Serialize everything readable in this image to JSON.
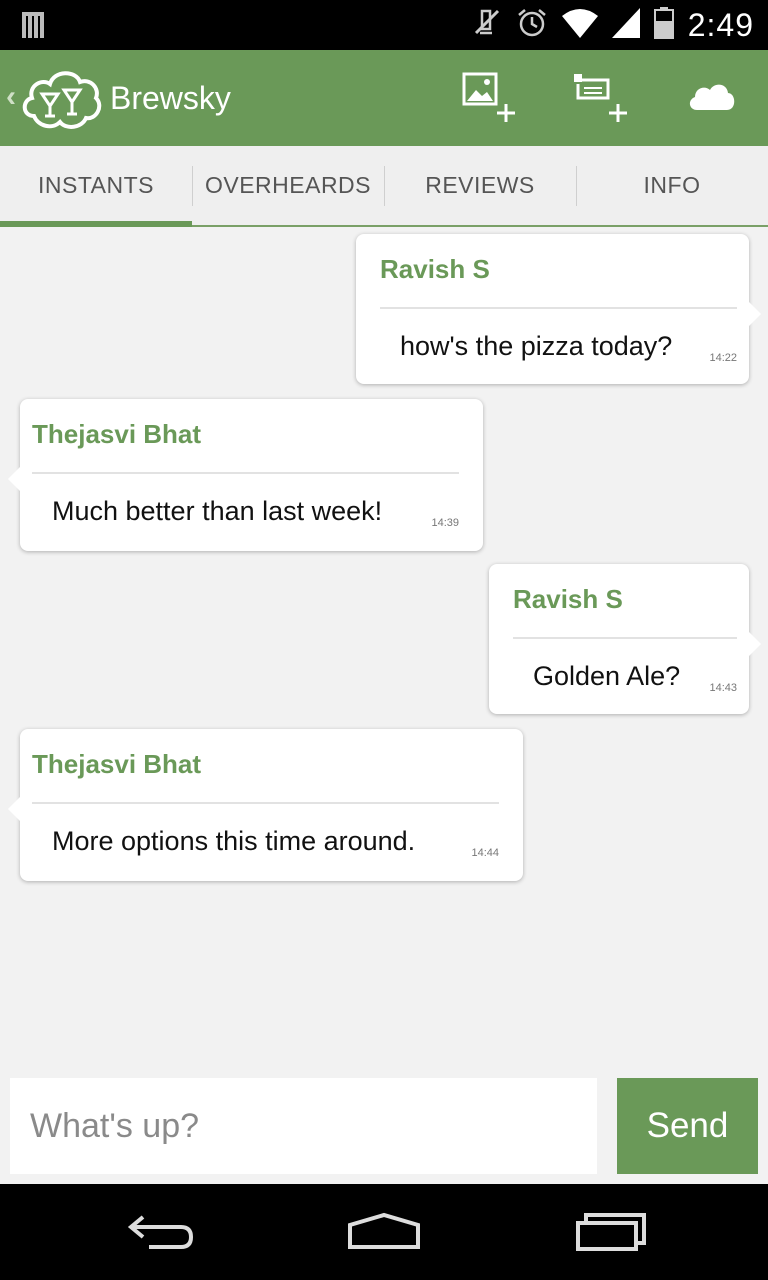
{
  "status_bar": {
    "time": "2:49",
    "icons": [
      "notification-icon",
      "mute-icon",
      "alarm-icon",
      "wifi-icon",
      "signal-icon",
      "battery-icon"
    ]
  },
  "action_bar": {
    "title": "Brewsky",
    "logo": "brewsky-logo",
    "actions": [
      "add-photo-icon",
      "add-post-icon",
      "cloud-icon"
    ],
    "color": "#6a9958"
  },
  "tabs": [
    {
      "label": "INSTANTS",
      "active": true
    },
    {
      "label": "OVERHEARDS",
      "active": false
    },
    {
      "label": "REVIEWS",
      "active": false
    },
    {
      "label": "INFO",
      "active": false
    }
  ],
  "messages": [
    {
      "sender": "Ravish S",
      "text": "how's the pizza today?",
      "time": "14:22",
      "side": "right"
    },
    {
      "sender": "Thejasvi Bhat",
      "text": "Much better than last week!",
      "time": "14:39",
      "side": "left"
    },
    {
      "sender": "Ravish S",
      "text": "Golden Ale?",
      "time": "14:43",
      "side": "right"
    },
    {
      "sender": "Thejasvi Bhat",
      "text": "More options this time around.",
      "time": "14:44",
      "side": "left"
    }
  ],
  "composer": {
    "placeholder": "What's up?",
    "value": "",
    "send_label": "Send"
  },
  "nav_bar": [
    "back-icon",
    "home-icon",
    "recents-icon"
  ]
}
